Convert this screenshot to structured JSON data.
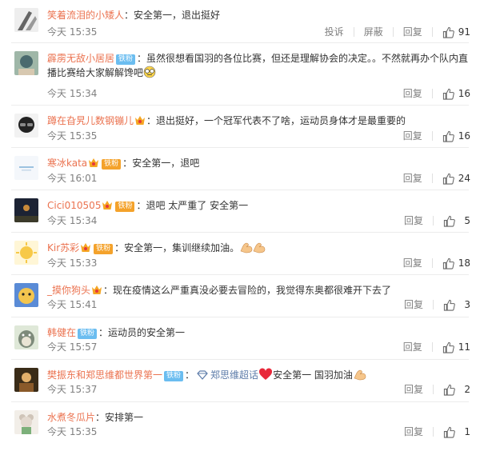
{
  "actions": {
    "report": "投诉",
    "block": "屏蔽",
    "reply": "回复"
  },
  "badges": {
    "fan": "铁粉"
  },
  "comments": [
    {
      "user": "笑着流泪的小矮人",
      "text": "安全第一，退出挺好",
      "time": "今天 15:35",
      "likes": "91"
    },
    {
      "user": "霹雳无敌小居居",
      "text": "虽然很想看国羽的各位比赛，但还是理解协会的决定。。不然就再办个队内直播比赛给大家解解馋吧",
      "time": "今天 15:34",
      "likes": "16"
    },
    {
      "user": "蹲在旮旯儿数钢镚儿",
      "text": "退出挺好，一个冠军代表不了啥，运动员身体才是最重要的",
      "time": "今天 15:35",
      "likes": "16"
    },
    {
      "user": "寒冰kata",
      "text": "安全第一，退吧",
      "time": "今天 16:01",
      "likes": "24"
    },
    {
      "user": "Cici010505",
      "text": "退吧 太严重了 安全第一",
      "time": "今天 15:34",
      "likes": "5"
    },
    {
      "user": "Kir苏彩",
      "text": "安全第一，集训继续加油。",
      "time": "今天 15:33",
      "likes": "18"
    },
    {
      "user": "_摸你狗头",
      "text": "现在疫情这么严重真没必要去冒险的，我觉得东奥都很难开下去了",
      "time": "今天 15:41",
      "likes": "3"
    },
    {
      "user": "韩健在",
      "text": "运动员的安全第一",
      "time": "今天 15:57",
      "likes": "11"
    },
    {
      "user": "樊振东和郑思维都世界第一",
      "topic": "郑思维超话",
      "text": "安全第一 国羽加油",
      "time": "今天 15:37",
      "likes": "2"
    },
    {
      "user": "水煮冬瓜片",
      "text": "安排第一",
      "time": "今天 15:35",
      "likes": "1"
    }
  ]
}
